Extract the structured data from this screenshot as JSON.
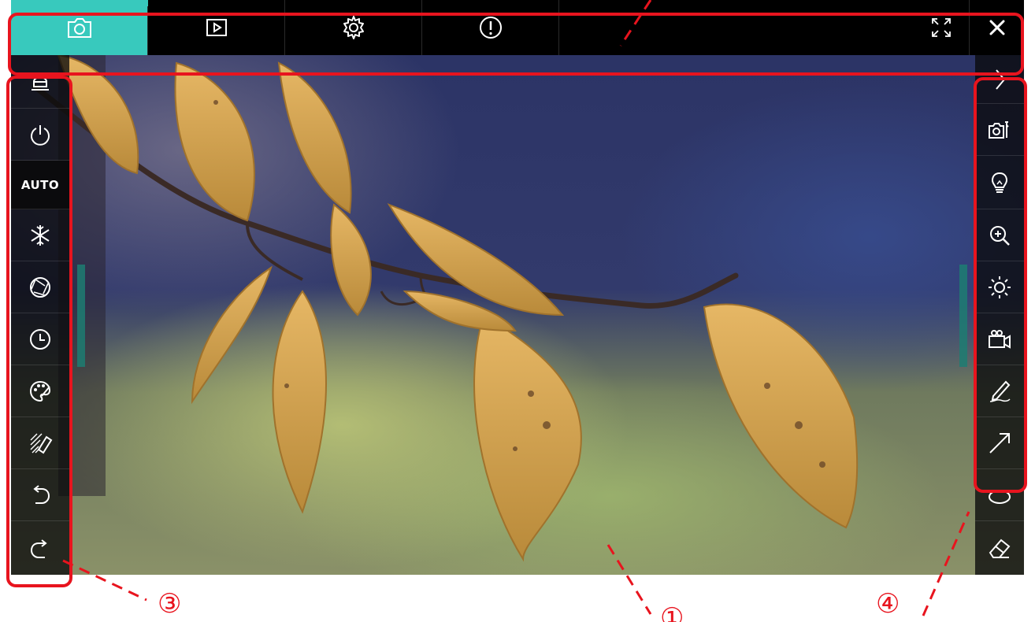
{
  "top_bar": {
    "tabs": [
      {
        "icon": "camera-icon",
        "active": true
      },
      {
        "icon": "play-icon",
        "active": false
      },
      {
        "icon": "gear-icon",
        "active": false
      },
      {
        "icon": "info-icon",
        "active": false
      }
    ],
    "right_buttons": [
      {
        "icon": "fullscreen-icon"
      },
      {
        "icon": "close-icon"
      }
    ],
    "accent_color": "#38c9bd"
  },
  "left_toolbar": {
    "items": [
      {
        "icon": "visualizer-icon"
      },
      {
        "icon": "power-icon"
      },
      {
        "label": "AUTO"
      },
      {
        "icon": "freeze-icon"
      },
      {
        "icon": "aperture-icon"
      },
      {
        "icon": "timer-icon"
      },
      {
        "icon": "palette-icon"
      },
      {
        "icon": "eraser-pattern-icon"
      },
      {
        "icon": "undo-icon"
      },
      {
        "icon": "redo-icon"
      }
    ]
  },
  "right_toolbar": {
    "items": [
      {
        "icon": "collapse-arrow-icon"
      },
      {
        "icon": "camera-settings-icon"
      },
      {
        "icon": "lightbulb-icon"
      },
      {
        "icon": "zoom-in-icon"
      },
      {
        "icon": "brightness-icon"
      },
      {
        "icon": "video-record-icon"
      },
      {
        "icon": "pen-icon"
      },
      {
        "icon": "arrow-line-icon"
      },
      {
        "icon": "shape-icon"
      },
      {
        "icon": "eraser-icon"
      }
    ]
  },
  "annotations": {
    "color": "#e8141e",
    "callouts": [
      {
        "label": "③"
      },
      {
        "label": "①"
      },
      {
        "label": "④"
      }
    ]
  }
}
